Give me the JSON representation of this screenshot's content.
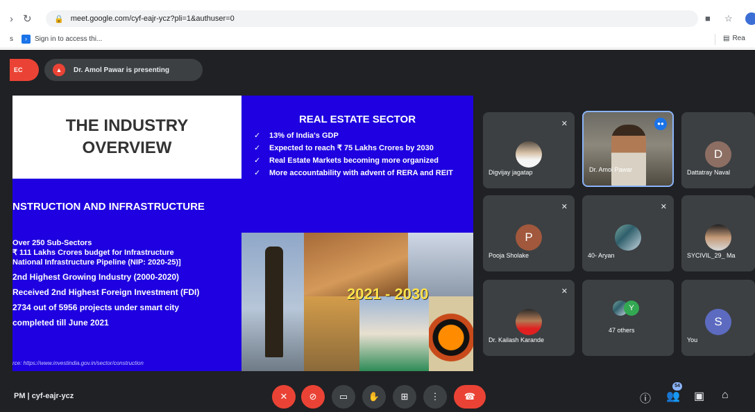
{
  "browser": {
    "url": "meet.google.com/cyf-eajr-ycz?pli=1&authuser=0",
    "bookmark": "Sign in to access thi...",
    "bookmark_apps": "s",
    "reading_list": "Rea"
  },
  "presenting": {
    "rec_label": "EC",
    "text": "Dr. Amol Pawar is presenting"
  },
  "slide": {
    "overview_line1": "THE INDUSTRY",
    "overview_line2": "OVERVIEW",
    "real_estate_title": "REAL ESTATE SECTOR",
    "real_estate_points": [
      "13% of India's GDP",
      "Expected to reach ₹ 75 Lakhs Crores by 2030",
      "Real Estate Markets becoming more organized",
      "More accountability with advent of RERA and REIT"
    ],
    "construction_title": "NSTRUCTION AND INFRASTRUCTURE",
    "construction_points": [
      "Over 250 Sub-Sectors",
      "₹ 111 Lakhs Crores budget for Infrastructure",
      "National Infrastructure Pipeline (NIP: 2020-25)]",
      "2nd Highest Growing Industry (2000-2020)",
      "Received 2nd Highest Foreign Investment (FDI)",
      "2734 out of 5956 projects under smart city",
      "completed till June 2021"
    ],
    "source": "rce: https://www.investindia.gov.in/sector/construction",
    "collage_year": "2021 - 2030"
  },
  "participants": [
    {
      "name": "Digvijay jagatap",
      "initial": ""
    },
    {
      "name": "Dr. Amol Pawar",
      "initial": ""
    },
    {
      "name": "Dattatray Naval",
      "initial": "D",
      "color": "#8d6e63"
    },
    {
      "name": "Pooja Sholake",
      "initial": "P",
      "color": "#a1583c"
    },
    {
      "name": "40- Aryan",
      "initial": ""
    },
    {
      "name": "SYCIVIL_29_ Ma",
      "initial": ""
    },
    {
      "name": "Dr. Kailash Karande",
      "initial": ""
    },
    {
      "name": "47 others",
      "initial": "Y",
      "color": "#33a852"
    },
    {
      "name": "You",
      "initial": "S",
      "color": "#5c6bc0"
    }
  ],
  "bottom_bar": {
    "meeting_info": "PM | cyf-eajr-ycz",
    "participant_count": "54"
  },
  "colors": {
    "meet_bg": "#202124",
    "tile_bg": "#3c4043",
    "slide_blue": "#1e00e0",
    "red": "#ea4335",
    "accent": "#8ab4f8"
  }
}
